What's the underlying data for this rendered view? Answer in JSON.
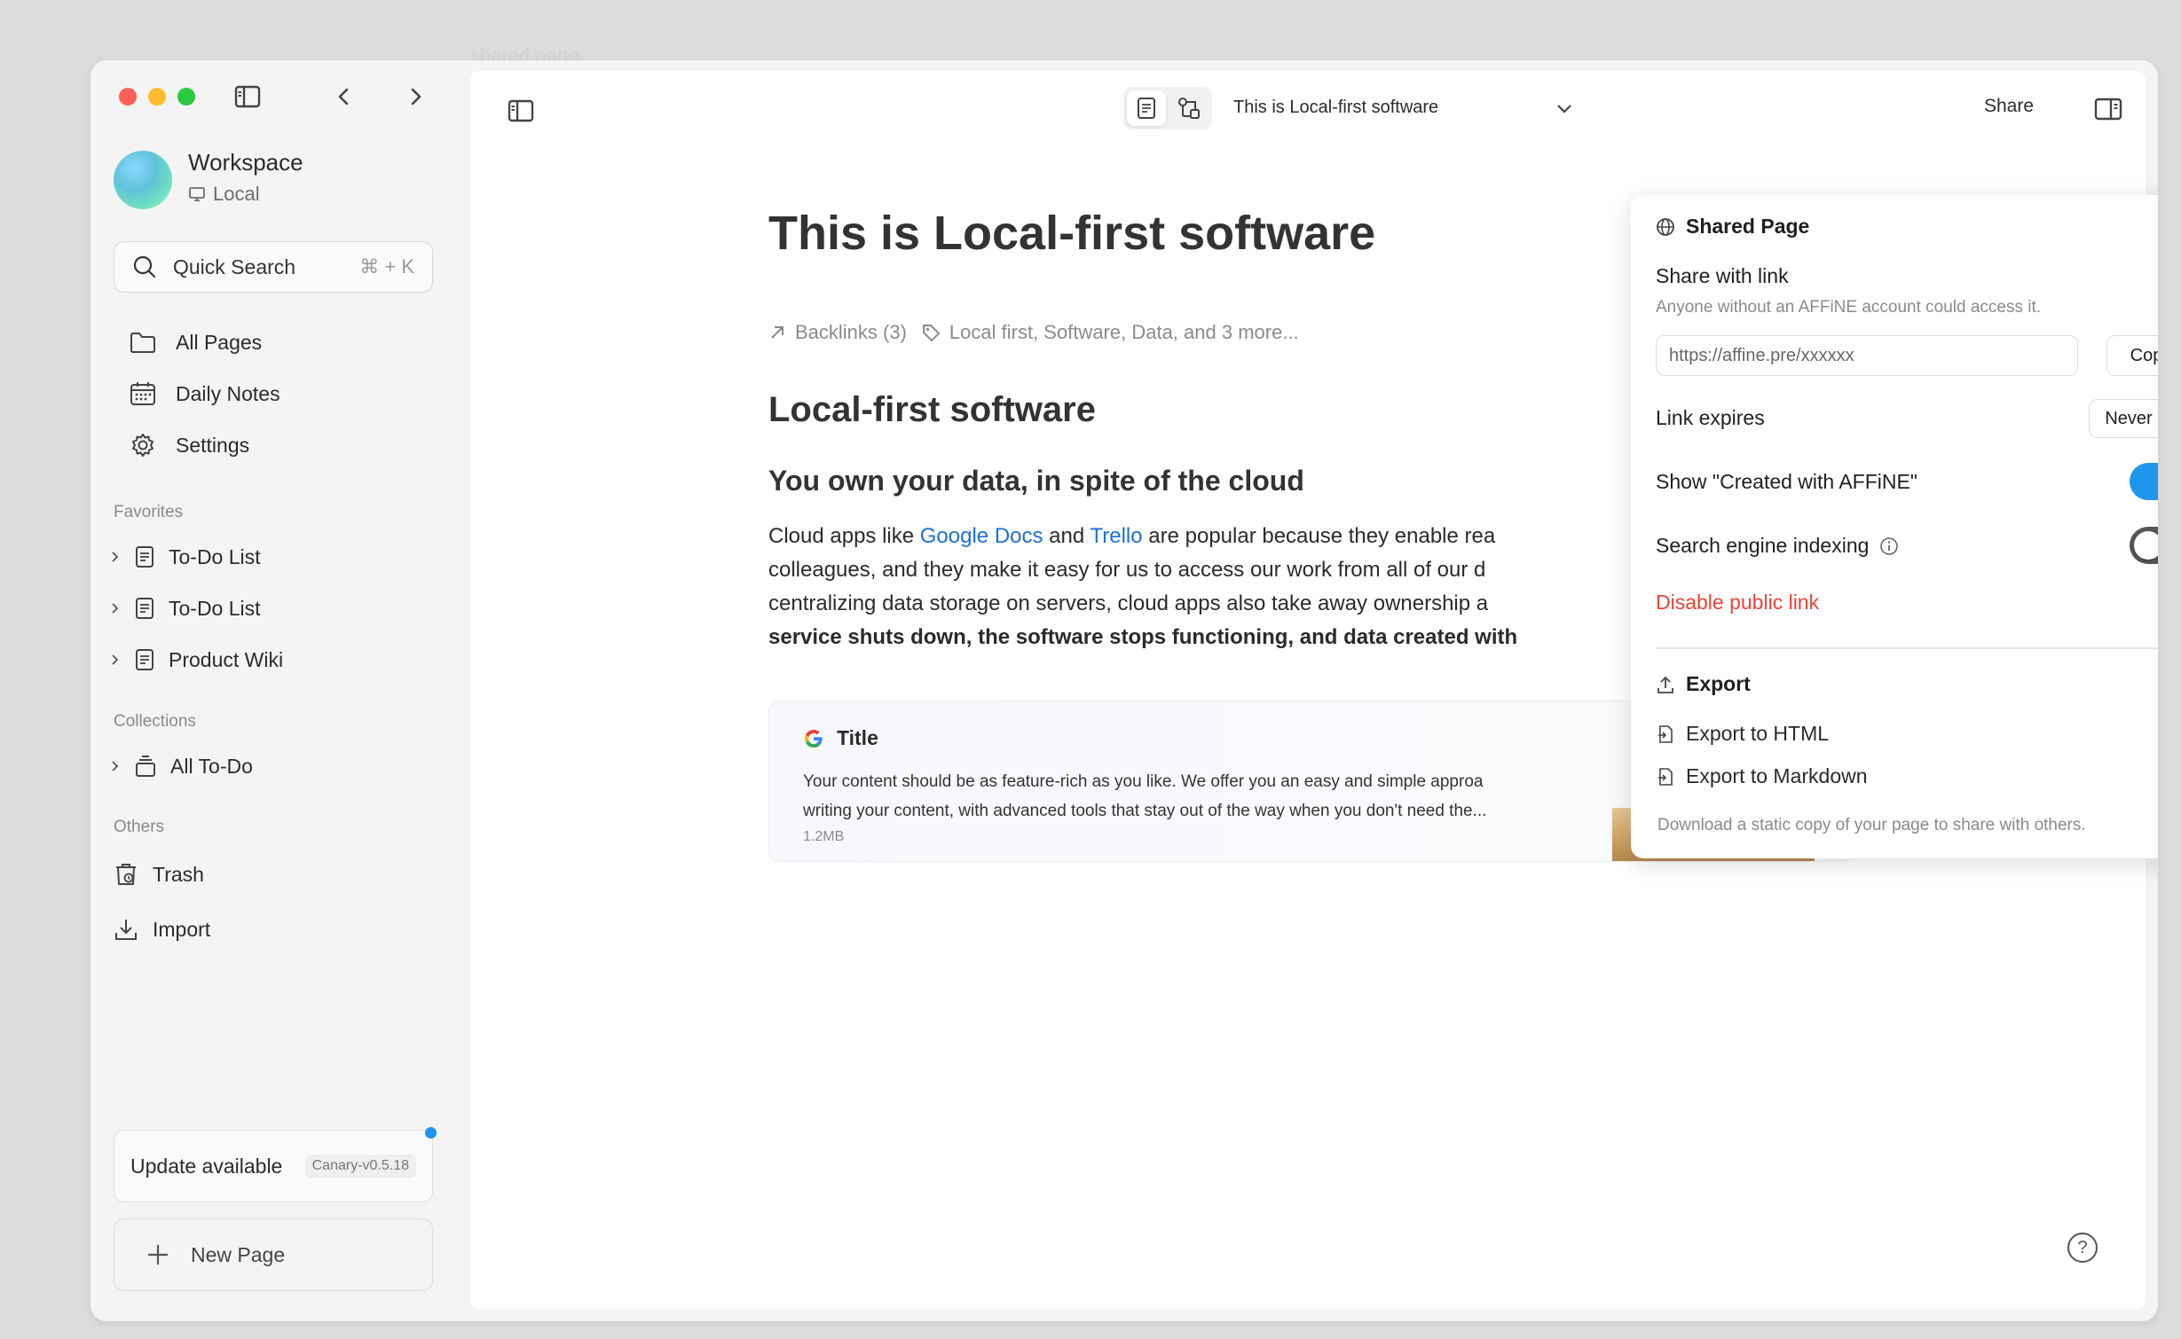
{
  "background_text": "shared page",
  "sidebar": {
    "workspace_name": "Workspace",
    "workspace_type": "Local",
    "search_label": "Quick Search",
    "search_shortcut": "⌘ + K",
    "nav": [
      "All Pages",
      "Daily Notes",
      "Settings"
    ],
    "favorites_label": "Favorites",
    "favorites": [
      "To-Do List",
      "To-Do List",
      "Product Wiki"
    ],
    "collections_label": "Collections",
    "collections": [
      "All To-Do"
    ],
    "others_label": "Others",
    "others": [
      "Trash",
      "Import"
    ],
    "update_label": "Update available",
    "update_version": "Canary-v0.5.18",
    "new_page_label": "New Page"
  },
  "header": {
    "page_title": "This is Local-first software",
    "share_label": "Share"
  },
  "doc": {
    "title": "This is Local-first software",
    "backlinks": "Backlinks (3)",
    "tags": "Local first, Software, Data, and 3 more...",
    "heading2": "Local-first software",
    "heading3": "You own your data, in spite of the cloud",
    "para": {
      "l1_a": "Cloud apps like ",
      "l1_link1": "Google Docs",
      "l1_b": " and ",
      "l1_link2": "Trello",
      "l1_c": " are popular because they enable rea",
      "l2": "colleagues, and they make it easy for us to access our work from all of our d",
      "l3": "centralizing data storage on servers, cloud apps also take away ownership a",
      "l4": "service shuts down, the software stops functioning, and data created with"
    },
    "card": {
      "title": "Title",
      "desc_1": "Your content should be as feature-rich as you like. We offer you an easy and simple approa",
      "desc_2": "writing your content, with advanced tools that stay out of the way when  you don't need the...",
      "size": "1.2MB"
    }
  },
  "share_popover": {
    "title": "Shared Page",
    "share_with_link": "Share with link",
    "share_sub": "Anyone without an AFFiNE account could access it.",
    "link_url": "https://affine.pre/xxxxxx",
    "copy_label": "Copy",
    "link_expires_label": "Link expires",
    "link_expires_value": "Never",
    "created_with_label": "Show \"Created with AFFiNE\"",
    "created_with_on": true,
    "search_indexing_label": "Search engine indexing",
    "search_indexing_on": false,
    "disable_label": "Disable public link",
    "export_title": "Export",
    "export_html": "Export to HTML",
    "export_markdown": "Export to Markdown",
    "export_footer": "Download a static copy of your page to share with others."
  },
  "help_label": "?",
  "colors": {
    "accent": "#1e96eb",
    "danger": "#eb4335",
    "link": "#1e6fd9"
  }
}
